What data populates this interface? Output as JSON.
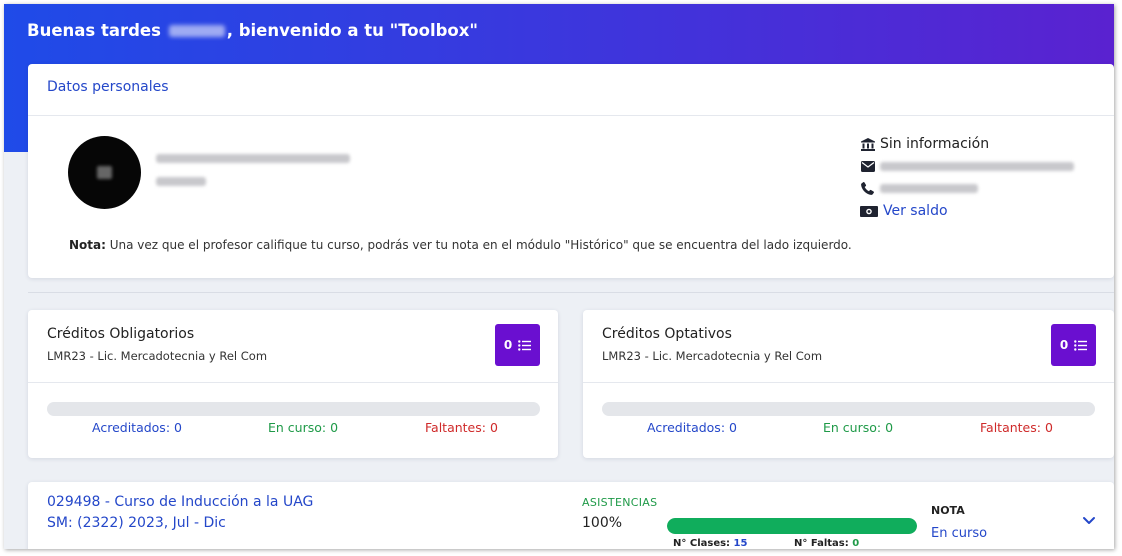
{
  "header": {
    "greeting_prefix": "Buenas tardes",
    "greeting_suffix": ", bienvenido a tu \"Toolbox\""
  },
  "personal": {
    "title": "Datos personales",
    "institution": "Sin información",
    "balance_link": "Ver saldo",
    "note_label": "Nota:",
    "note_text": " Una vez que el profesor califique tu curso, podrás ver tu nota en el módulo \"Histórico\" que se encuentra del lado izquierdo."
  },
  "credits": [
    {
      "title": "Créditos Obligatorios",
      "program": "LMR23 - Lic. Mercadotecnia y Rel Com",
      "count": "0",
      "progress": 0,
      "acreditados": "Acreditados: 0",
      "en_curso": "En curso: 0",
      "faltantes": "Faltantes: 0"
    },
    {
      "title": "Créditos Optativos",
      "program": "LMR23 - Lic. Mercadotecnia y Rel Com",
      "count": "0",
      "progress": 0,
      "acreditados": "Acreditados: 0",
      "en_curso": "En curso: 0",
      "faltantes": "Faltantes: 0"
    }
  ],
  "course": {
    "name": "029498 - Curso de Inducción a la UAG",
    "period": "SM: (2322) 2023, Jul - Dic",
    "attendance_label": "ASISTENCIAS",
    "attendance_value": "100%",
    "attendance_fraction": 1.0,
    "classes_label": "N° Clases: ",
    "classes_value": "15",
    "absences_label": "N° Faltas: ",
    "absences_value": "0",
    "grade_label": "NOTA",
    "grade_value": "En curso"
  },
  "colors": {
    "accent_blue": "#2447c9",
    "purple_button": "#6a0fd0",
    "green": "#10ad5c",
    "red": "#cf2a2a"
  }
}
